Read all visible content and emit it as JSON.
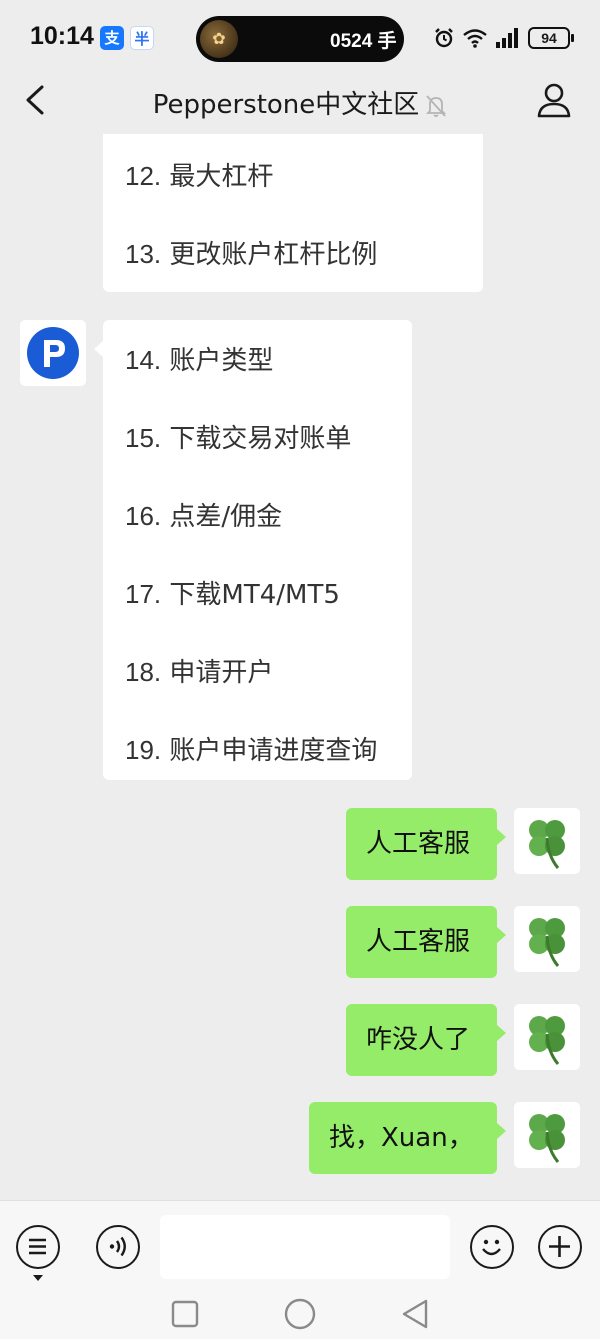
{
  "status_bar": {
    "time": "10:14",
    "badge_alipay": "支",
    "badge_other": "半",
    "media_text": "0524 手",
    "battery": "94"
  },
  "nav": {
    "title": "Pepperstone中文社区"
  },
  "menu_top": [
    {
      "num": "12.",
      "label": " 最大杠杆"
    },
    {
      "num": "13.",
      "label": " 更改账户杠杆比例"
    }
  ],
  "menu_main": [
    {
      "num": "14.",
      "label": " 账户类型"
    },
    {
      "num": "15.",
      "label": " 下载交易对账单"
    },
    {
      "num": "16.",
      "label": " 点差/佣金"
    },
    {
      "num": "17.",
      "label": " 下载MT4/MT5"
    },
    {
      "num": "18.",
      "label": " 申请开户"
    },
    {
      "num": "19.",
      "label": " 账户申请进度查询"
    }
  ],
  "outgoing": [
    {
      "text": "人工客服"
    },
    {
      "text": "人工客服"
    },
    {
      "text": "咋没人了"
    },
    {
      "text": "找，Xuan，"
    }
  ],
  "icons": {
    "back": "chevron-left-icon",
    "mute": "bell-off-icon",
    "profile": "person-icon",
    "voice": "voice-icon",
    "menu": "list-icon",
    "emoji": "smiley-icon",
    "plus": "plus-icon"
  },
  "colors": {
    "background": "#ededed",
    "outgoing_bubble": "#95ec69",
    "incoming_bubble": "#ffffff",
    "pepperstone_blue": "#1a5bd6"
  }
}
